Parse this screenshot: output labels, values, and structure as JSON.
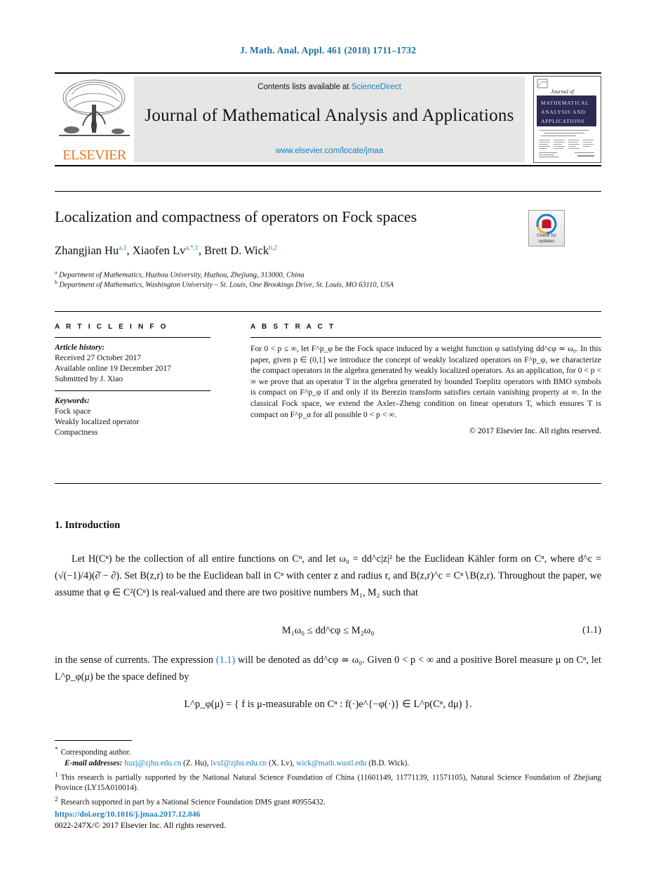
{
  "running_head": "J. Math. Anal. Appl. 461 (2018) 1711–1732",
  "masthead": {
    "contents_prefix": "Contents lists available at ",
    "sciencedirect": "ScienceDirect",
    "journal_title": "Journal of Mathematical Analysis and Applications",
    "journal_url": "www.elsevier.com/locate/jmaa",
    "publisher": "ELSEVIER",
    "publisher_logo_icon": "elsevier-tree-icon",
    "cover": {
      "line1": "Journal of",
      "line2": "MATHEMATICAL",
      "line3": "ANALYSIS AND",
      "line4": "APPLICATIONS"
    }
  },
  "article": {
    "title": "Localization and compactness of operators on Fock spaces",
    "crossmark": {
      "icon": "crossmark-icon",
      "label_line1": "Check for",
      "label_line2": "updates"
    },
    "authors": [
      {
        "name": "Zhangjian Hu",
        "sup": "a,1"
      },
      {
        "name": "Xiaofen Lv",
        "sup": "a,*,1"
      },
      {
        "name": "Brett D. Wick",
        "sup": "b,2"
      }
    ],
    "affiliations": [
      {
        "mark": "a",
        "text": "Department of Mathematics, Huzhou University, Huzhou, Zhejiang, 313000, China"
      },
      {
        "mark": "b",
        "text": "Department of Mathematics, Washington University – St. Louis, One Brookings Drive, St. Louis, MO 63110, USA"
      }
    ]
  },
  "info": {
    "heading": "A R T I C L E   I N F O",
    "history_label": "Article history:",
    "history": [
      "Received 27 October 2017",
      "Available online 19 December 2017",
      "Submitted by J. Xiao"
    ],
    "keywords_label": "Keywords:",
    "keywords": [
      "Fock space",
      "Weakly localized operator",
      "Compactness"
    ]
  },
  "abstract": {
    "heading": "A B S T R A C T",
    "text": "For 0 < p ≤ ∞, let F^p_φ be the Fock space induced by a weight function φ satisfying dd^cφ ≃ ω₀. In this paper, given p ∈ (0,1] we introduce the concept of weakly localized operators on F^p_φ, we characterize the compact operators in the algebra generated by weakly localized operators. As an application, for 0 < p < ∞ we prove that an operator T in the algebra generated by bounded Toeplitz operators with BMO symbols is compact on F^p_φ if and only if its Berezin transform satisfies certain vanishing property at ∞. In the classical Fock space, we extend the Axler–Zheng condition on linear operators T, which ensures T is compact on F^p_α for all possible 0 < p < ∞.",
    "copyright": "© 2017 Elsevier Inc. All rights reserved."
  },
  "body": {
    "section_number_title": "1. Introduction",
    "paragraph_1": "Let H(Cⁿ) be the collection of all entire functions on Cⁿ, and let ω₀ = dd^c|z|² be the Euclidean Kähler form on Cⁿ, where d^c = (√(−1)/4)(∂̄ − ∂). Set B(z,r) to be the Euclidean ball in Cⁿ with center z and radius r, and B(z,r)^c = Cⁿ∖B(z,r). Throughout the paper, we assume that φ ∈ C²(Cⁿ) is real-valued and there are two positive numbers M₁, M₂ such that",
    "equation_1": "M₁ω₀ ≤ dd^cφ ≤ M₂ω₀",
    "equation_1_number": "(1.1)",
    "paragraph_2_a": "in the sense of currents. The expression ",
    "paragraph_2_ref": "(1.1)",
    "paragraph_2_b": " will be denoted as dd^cφ ≃ ω₀. Given 0 < p < ∞ and a positive Borel measure μ on Cⁿ, let L^p_φ(μ) be the space defined by",
    "equation_2": "L^p_φ(μ) = { f is μ-measurable on Cⁿ : f(·)e^{−φ(·)} ∈ L^p(Cⁿ, dμ) }."
  },
  "footnotes": {
    "corresponding_mark": "*",
    "corresponding": "Corresponding author.",
    "email_label": "E-mail addresses:",
    "emails": [
      {
        "address": "huzj@zjhu.edu.cn",
        "person": "(Z. Hu)"
      },
      {
        "address": "lvxf@zjhu.edu.cn",
        "person": "(X. Lv)"
      },
      {
        "address": "wick@math.wustl.edu",
        "person": "(B.D. Wick)"
      }
    ],
    "note1_mark": "1",
    "note1": "This research is partially supported by the National Natural Science Foundation of China (11601149, 11771139, 11571105), Natural Science Foundation of Zhejiang Province (LY15A010014).",
    "note2_mark": "2",
    "note2": "Research supported in part by a National Science Foundation DMS grant #0955432."
  },
  "footer": {
    "doi": "https://doi.org/10.1016/j.jmaa.2017.12.046",
    "issn_copyright": "0022-247X/© 2017 Elsevier Inc. All rights reserved."
  },
  "colors": {
    "link": "#1a7fc1",
    "elsevier_orange": "#E87722",
    "cover_navy": "#2b2b55"
  }
}
